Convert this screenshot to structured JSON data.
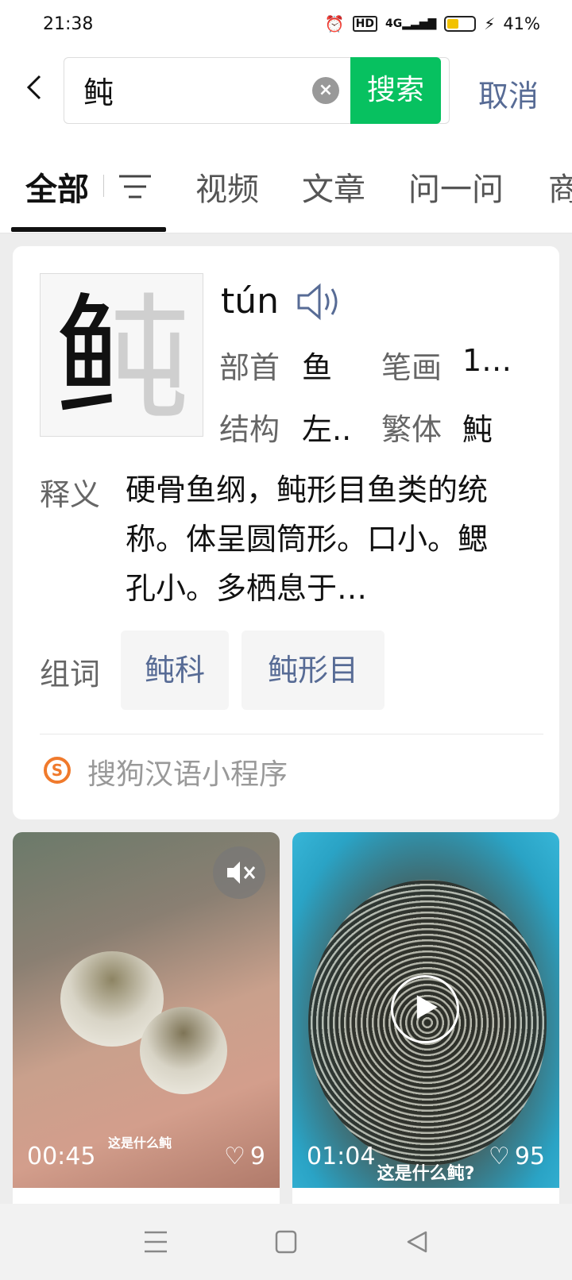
{
  "status": {
    "time": "21:38",
    "signal": "4G",
    "hd": "HD",
    "battery": "41%"
  },
  "search": {
    "back_icon": "back-arrow-icon",
    "query": "鲀",
    "search_label": "搜索",
    "cancel_label": "取消"
  },
  "tabs": [
    {
      "label": "全部",
      "active": true
    },
    {
      "label": "视频",
      "active": false
    },
    {
      "label": "文章",
      "active": false
    },
    {
      "label": "问一问",
      "active": false
    },
    {
      "label": "商",
      "active": false
    }
  ],
  "dict": {
    "character": "鲀",
    "pinyin": "tún",
    "radical_label": "部首",
    "radical_value": "鱼",
    "strokes_label": "笔画",
    "strokes_value": "1…",
    "structure_label": "结构",
    "structure_value": "左..",
    "traditional_label": "繁体",
    "traditional_value": "魨",
    "definition_label": "释义",
    "definition": "硬骨鱼纲，鲀形目鱼类的统称。体呈圆筒形。口小。鳃孔小。多栖息于…",
    "words_label": "组词",
    "words": [
      "鲀科",
      "鲀形目"
    ],
    "source": "搜狗汉语小程序"
  },
  "videos": [
    {
      "duration": "00:45",
      "likes": "9",
      "subtitle": "这是什么鲀"
    },
    {
      "duration": "01:04",
      "likes": "95",
      "subtitle": "这是什么鲀?"
    }
  ],
  "colors": {
    "accent_green": "#07c160",
    "link_blue": "#576b95"
  }
}
